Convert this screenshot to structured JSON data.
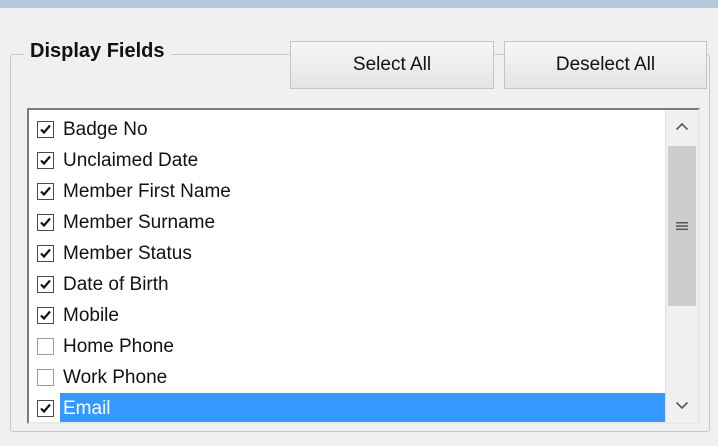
{
  "group": {
    "title": "Display Fields"
  },
  "buttons": {
    "select_all": "Select All",
    "deselect_all": "Deselect All"
  },
  "fields": [
    {
      "label": "Badge No",
      "checked": true,
      "selected": false
    },
    {
      "label": "Unclaimed Date",
      "checked": true,
      "selected": false
    },
    {
      "label": "Member First Name",
      "checked": true,
      "selected": false
    },
    {
      "label": "Member Surname",
      "checked": true,
      "selected": false
    },
    {
      "label": "Member Status",
      "checked": true,
      "selected": false
    },
    {
      "label": "Date of Birth",
      "checked": true,
      "selected": false
    },
    {
      "label": "Mobile",
      "checked": true,
      "selected": false
    },
    {
      "label": "Home Phone",
      "checked": false,
      "selected": false
    },
    {
      "label": "Work Phone",
      "checked": false,
      "selected": false
    },
    {
      "label": "Email",
      "checked": true,
      "selected": true
    }
  ],
  "scrollbar": {
    "up_icon": "chevron-up-icon",
    "down_icon": "chevron-down-icon",
    "thumb_icon": "grip-lines-icon"
  },
  "colors": {
    "selection": "#3399ff",
    "header_strip": "#b4c9de",
    "panel": "#f0f0f0"
  }
}
